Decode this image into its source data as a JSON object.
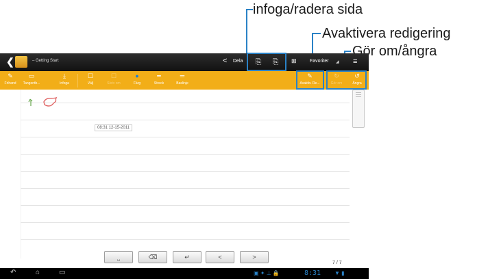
{
  "callouts": {
    "insert_delete": "infoga/radera sida",
    "disable_editing": "Avaktivera redigering",
    "redo_undo": "Gör om/ångra"
  },
  "titlebar": {
    "back_glyph": "❮",
    "title": "– Getting Start",
    "share_label": "Dela",
    "insert_glyph": "⎘",
    "delete_glyph": "⎘",
    "grid_glyph": "⊞",
    "favorites": "Favoriter",
    "menu_glyph": "≡"
  },
  "toolbar": {
    "tools": [
      {
        "id": "freehand",
        "label": "Frihand",
        "icon": "✎"
      },
      {
        "id": "keyboard",
        "label": "Tangentb...",
        "icon": "▭"
      },
      {
        "id": "insert",
        "label": "Infoga",
        "icon": "⤓"
      },
      {
        "id": "select",
        "label": "Välj",
        "icon": "☐"
      },
      {
        "id": "write",
        "label": "Skriv om",
        "icon": "☐"
      },
      {
        "id": "color",
        "label": "Färg",
        "icon": "●"
      },
      {
        "id": "stroke",
        "label": "Streck",
        "icon": "━"
      },
      {
        "id": "baseline",
        "label": "Baslinje",
        "icon": "═"
      },
      {
        "id": "disable_edit",
        "label": "Avaktiv. Re...",
        "icon": "✎"
      },
      {
        "id": "redo",
        "label": "Gör om",
        "icon": "↻"
      },
      {
        "id": "undo",
        "label": "Ångra",
        "icon": "↺"
      }
    ],
    "accent_color": "#f2ae18",
    "highlight_color": "#2a82c6"
  },
  "content": {
    "timestamp": "08:31 12-15-2011",
    "keys": {
      "space": "⎵",
      "backspace": "⌫",
      "enter": "↵",
      "prev": "<",
      "next": ">"
    },
    "page_current": "7",
    "page_total": "7"
  },
  "sysbar": {
    "back": "↶",
    "home": "⌂",
    "recent": "▭",
    "clock": "8:31"
  }
}
